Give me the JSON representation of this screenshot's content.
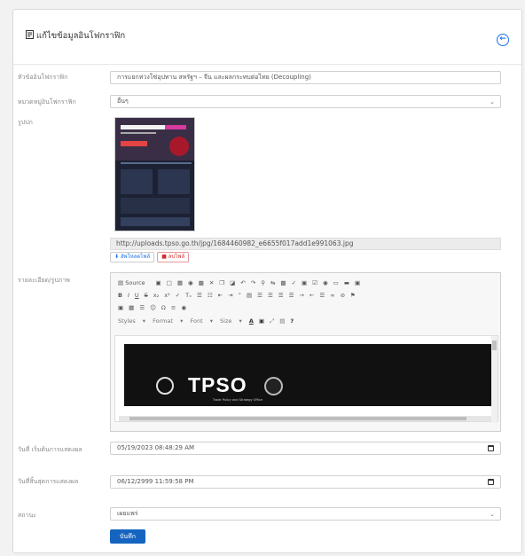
{
  "header": {
    "title": "แก้ไขข้อมูลอินโฟกราฟิก",
    "back_icon": "back-arrow-circle-icon"
  },
  "form": {
    "title_label": "หัวข้ออินโฟกราฟิก",
    "title_value": "การแยกห่วงโซ่อุปทาน สหรัฐฯ – จีน และผลกระทบต่อไทย (Decoupling)",
    "category_label": "หมวดหมู่อินโฟกราฟิก",
    "category_value": "อื่นๆ",
    "cover_label": "รูปปก",
    "cover_url": "http://uploads.tpso.go.th/jpg/1684460982_e6655f017add1e991063.jpg",
    "upload_label": "อัพโหลดไฟล์",
    "delete_label": "ลบไฟล์",
    "detail_label": "รายละเอียด/รูปภาพ",
    "start_label": "วันที่ เริ่มต้นการแสดงผล",
    "start_value": "05/19/2023 08:48:29 AM",
    "end_label": "วันที่สิ้นสุดการแสดงผล",
    "end_value": "06/12/2999 11:59:58 PM",
    "status_label": "สถานะ",
    "status_value": "เผยแพร่",
    "save_label": "บันทึก"
  },
  "editor": {
    "source_label": "Source",
    "styles_label": "Styles",
    "format_label": "Format",
    "font_label": "Font",
    "size_label": "Size",
    "content_text": "TPSO",
    "content_subtext": "Trade Policy and Strategy Office"
  },
  "colors": {
    "accent": "#1565c0",
    "danger": "#d32f2f"
  }
}
